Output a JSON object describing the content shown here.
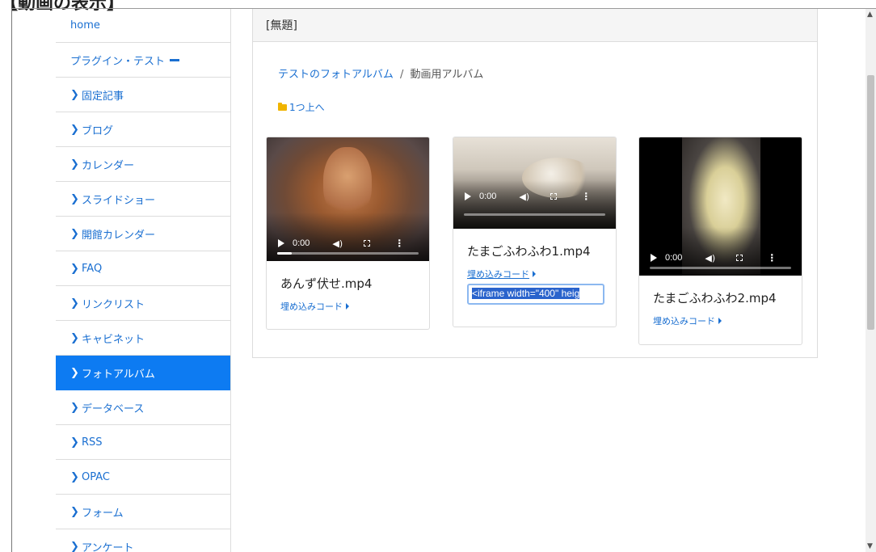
{
  "caption": "【動画の表示】",
  "sidebar": {
    "items": [
      {
        "label": "home",
        "chevron": false,
        "active": false
      },
      {
        "label": "プラグイン・テスト",
        "chevron": false,
        "active": false,
        "dash": true
      },
      {
        "label": "固定記事",
        "chevron": true,
        "active": false
      },
      {
        "label": "ブログ",
        "chevron": true,
        "active": false
      },
      {
        "label": "カレンダー",
        "chevron": true,
        "active": false
      },
      {
        "label": "スライドショー",
        "chevron": true,
        "active": false
      },
      {
        "label": "開館カレンダー",
        "chevron": true,
        "active": false
      },
      {
        "label": "FAQ",
        "chevron": true,
        "active": false
      },
      {
        "label": "リンクリスト",
        "chevron": true,
        "active": false
      },
      {
        "label": "キャビネット",
        "chevron": true,
        "active": false
      },
      {
        "label": "フォトアルバム",
        "chevron": true,
        "active": true
      },
      {
        "label": "データベース",
        "chevron": true,
        "active": false
      },
      {
        "label": "RSS",
        "chevron": true,
        "active": false
      },
      {
        "label": "OPAC",
        "chevron": true,
        "active": false
      },
      {
        "label": "フォーム",
        "chevron": true,
        "active": false
      },
      {
        "label": "アンケート",
        "chevron": true,
        "active": false
      }
    ],
    "chevron_glyph": "❯"
  },
  "panel": {
    "title": "[無題]",
    "breadcrumb": {
      "link": "テストのフォトアルバム",
      "separator": "/",
      "current": "動画用アルバム"
    },
    "up_link": "1つ上へ"
  },
  "cards": [
    {
      "title": "あんず伏せ.mp4",
      "time": "0:00",
      "embed_label": "埋め込みコード",
      "progress": 0.1
    },
    {
      "title": "たまごふわふわ1.mp4",
      "time": "0:00",
      "embed_label": "埋め込みコード",
      "progress": 0,
      "embed_value": "<iframe width=\"400\" heig"
    },
    {
      "title": "たまごふわふわ2.mp4",
      "time": "0:00",
      "embed_label": "埋め込みコード",
      "progress": 0
    }
  ],
  "colors": {
    "link": "#1a6fd1",
    "active_bg": "#0d7bf2",
    "folder": "#f0b400"
  }
}
